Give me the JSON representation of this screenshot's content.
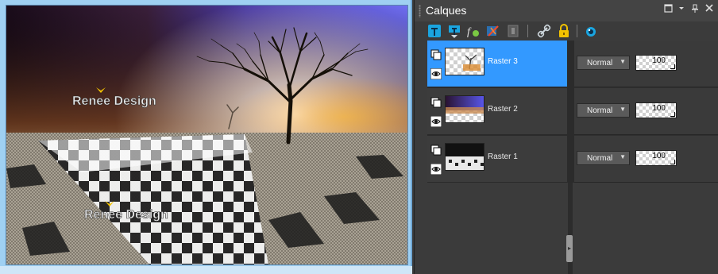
{
  "canvas": {
    "watermark_top": "Renee Design",
    "watermark_bottom": "Renee Design"
  },
  "panel": {
    "title": "Calques",
    "header_buttons": [
      "restore-icon",
      "menu-chevron-icon",
      "pin-icon",
      "close-icon"
    ],
    "toolbar_icons": [
      "new-layer-icon",
      "merge-down-icon",
      "layer-styles-fx-icon",
      "delete-layer-icon",
      "mask-icon",
      "link-icon",
      "lock-icon",
      "eye-palette-icon"
    ]
  },
  "layers": [
    {
      "name": "Raster 3",
      "blend": "Normal",
      "opacity": "100",
      "selected": true
    },
    {
      "name": "Raster 2",
      "blend": "Normal",
      "opacity": "100",
      "selected": false
    },
    {
      "name": "Raster 1",
      "blend": "Normal",
      "opacity": "100",
      "selected": false
    }
  ],
  "colors": {
    "selection": "#3399ff",
    "panel_bg": "#3b3b3b",
    "canvas_frame": "#9fd0f2"
  }
}
